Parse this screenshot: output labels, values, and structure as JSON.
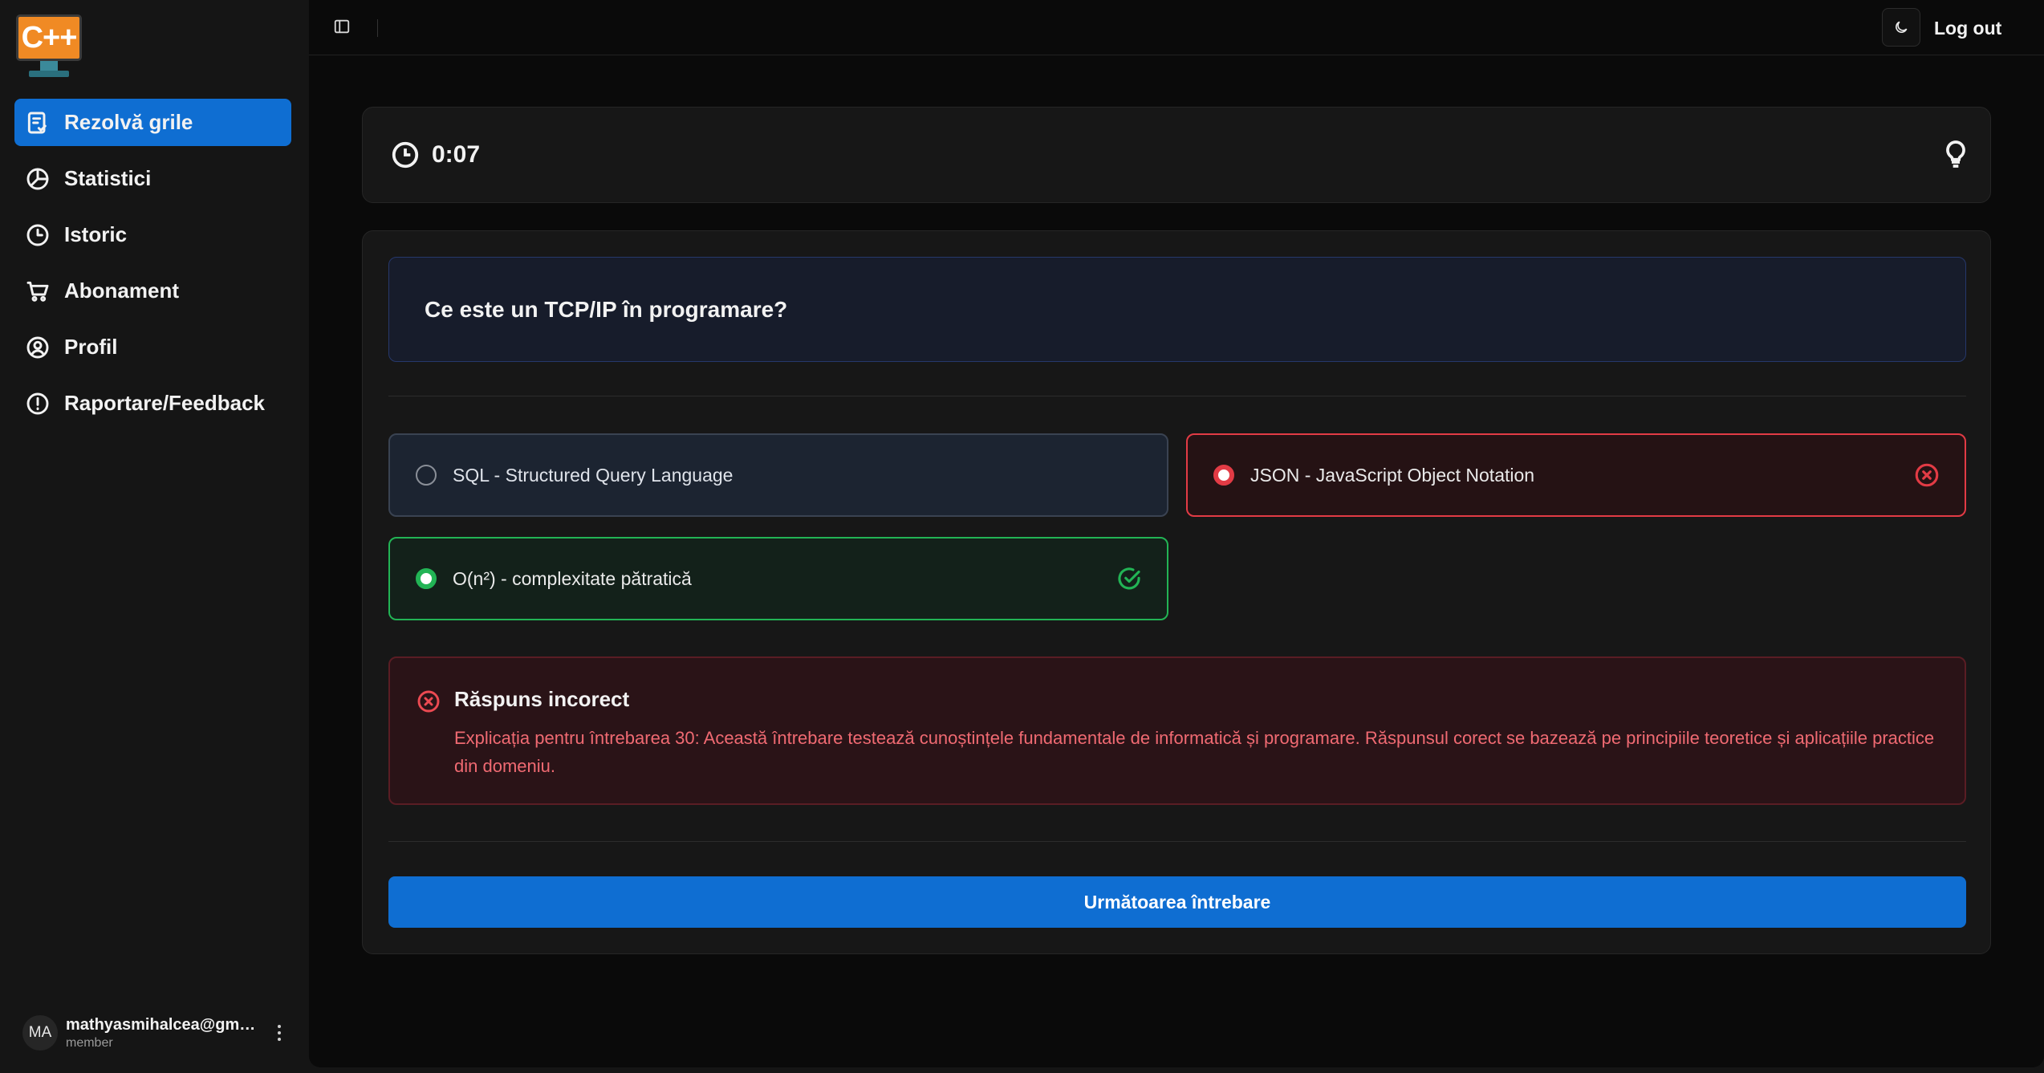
{
  "logo": {
    "text": "C++"
  },
  "sidebar": {
    "items": [
      {
        "label": "Rezolvă grile",
        "icon": "clipboard-check-icon",
        "active": true
      },
      {
        "label": "Statistici",
        "icon": "pie-chart-icon",
        "active": false
      },
      {
        "label": "Istoric",
        "icon": "clock-icon",
        "active": false
      },
      {
        "label": "Abonament",
        "icon": "cart-icon",
        "active": false
      },
      {
        "label": "Profil",
        "icon": "user-circle-icon",
        "active": false
      },
      {
        "label": "Raportare/Feedback",
        "icon": "alert-circle-icon",
        "active": false
      }
    ]
  },
  "user": {
    "initials": "MA",
    "email": "mathyasmihalcea@gmail.com",
    "role": "member"
  },
  "topbar": {
    "logout_label": "Log out",
    "theme_icon": "moon-icon",
    "toggle_icon": "sidebar-toggle-icon"
  },
  "timer": {
    "value": "0:07",
    "icon": "clock-icon",
    "hint_icon": "lightbulb-icon"
  },
  "question": {
    "text": "Ce este un TCP/IP în programare?"
  },
  "options": [
    {
      "label": "SQL - Structured Query Language",
      "state": "neutral"
    },
    {
      "label": "JSON - JavaScript Object Notation",
      "state": "wrong"
    },
    {
      "label": "O(n²) - complexitate pătratică",
      "state": "correct"
    }
  ],
  "feedback": {
    "title": "Răspuns incorect",
    "body": "Explicația pentru întrebarea 30: Această întrebare testează cunoștințele fundamentale de informatică și programare. Răspunsul corect se bazează pe principiile teoretice și aplicațiile practice din domeniu."
  },
  "next_button": {
    "label": "Următoarea întrebare"
  },
  "colors": {
    "accent": "#0f6ed2",
    "wrong": "#e23b45",
    "correct": "#22b455",
    "logo": "#f08a24"
  }
}
